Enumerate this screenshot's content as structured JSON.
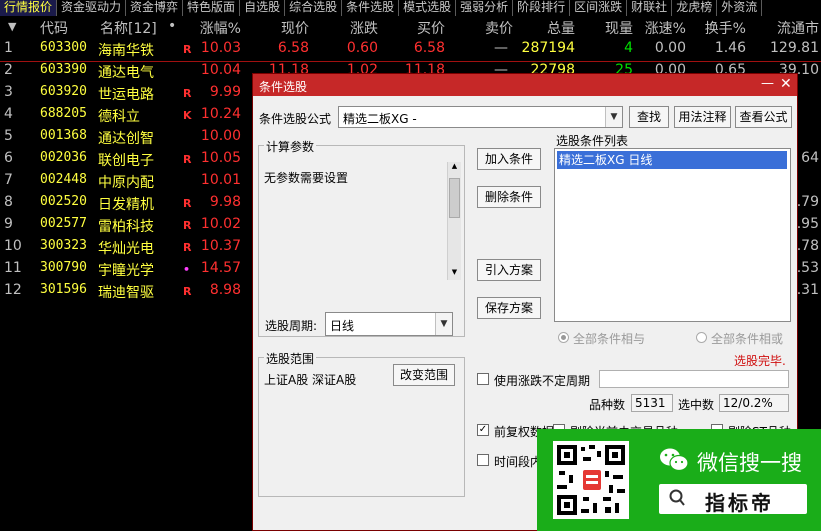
{
  "tabs": [
    "行情报价",
    "资金驱动力",
    "资金博弈",
    "特色版面",
    "自选股",
    "综合选股",
    "条件选股",
    "模式选股",
    "强弱分析",
    "阶段排行",
    "区间涨跌",
    "财联社",
    "龙虎榜",
    "外资流"
  ],
  "columns": {
    "sort": "▼",
    "code": "代码",
    "name": "名称[12]",
    "dot": "•",
    "chg": "涨幅%",
    "price": "现价",
    "diff": "涨跌",
    "bid": "买价",
    "ask": "卖价",
    "vol": "总量",
    "cur": "现量",
    "spd": "涨速%",
    "turn": "换手%",
    "float": "流通市"
  },
  "rows": [
    {
      "idx": "1",
      "code": "603300",
      "name": "海南华铁",
      "flag": "R",
      "chg": "10.03",
      "price": "6.58",
      "diff": "0.60",
      "bid": "6.58",
      "ask": "—",
      "vol": "287194",
      "cur": "4",
      "spd": "0.00",
      "turn": "1.46",
      "float": "129.81"
    },
    {
      "idx": "2",
      "code": "603390",
      "name": "通达电气",
      "flag": "",
      "chg": "10.04",
      "price": "11.18",
      "diff": "1.02",
      "bid": "11.18",
      "ask": "—",
      "vol": "22798",
      "cur": "25",
      "spd": "0.00",
      "turn": "0.65",
      "float": "39.10"
    },
    {
      "idx": "3",
      "code": "603920",
      "name": "世运电路",
      "flag": "R",
      "chg": "9.99",
      "float": ""
    },
    {
      "idx": "4",
      "code": "688205",
      "name": "德科立",
      "flag": "K",
      "chg": "10.24",
      "float": ""
    },
    {
      "idx": "5",
      "code": "001368",
      "name": "通达创智",
      "flag": "",
      "chg": "10.00",
      "float": ""
    },
    {
      "idx": "6",
      "code": "002036",
      "name": "联创电子",
      "flag": "R",
      "chg": "10.05",
      "float": "64"
    },
    {
      "idx": "7",
      "code": "002448",
      "name": "中原内配",
      "flag": "",
      "chg": "10.01",
      "float": ""
    },
    {
      "idx": "8",
      "code": "002520",
      "name": "日发精机",
      "flag": "R",
      "chg": "9.98",
      "float": ".79"
    },
    {
      "idx": "9",
      "code": "002577",
      "name": "雷柏科技",
      "flag": "R",
      "chg": "10.02",
      "float": ".95"
    },
    {
      "idx": "10",
      "code": "300323",
      "name": "华灿光电",
      "flag": "R",
      "chg": "10.37",
      "float": ".78"
    },
    {
      "idx": "11",
      "code": "300790",
      "name": "宇瞳光学",
      "flag": "•",
      "chg": "14.57",
      "float": ".53"
    },
    {
      "idx": "12",
      "code": "301596",
      "name": "瑞迪智驱",
      "flag": "R",
      "chg": "8.98",
      "float": ".31"
    }
  ],
  "dialog": {
    "title": "条件选股",
    "min": "—",
    "close": "✕",
    "formula_label": "条件选股公式",
    "formula_value": "精选二板XG  -",
    "find_btn": "查找",
    "usage_btn": "用法注释",
    "view_btn": "查看公式",
    "params_group": "计算参数",
    "params_text": "无参数需要设置",
    "add_btn": "加入条件",
    "del_btn": "删除条件",
    "import_btn": "引入方案",
    "save_btn": "保存方案",
    "list_label": "选股条件列表",
    "list_items": [
      "精选二板XG  日线"
    ],
    "period_label": "选股周期:",
    "period_value": "日线",
    "radio_and": "全部条件相与",
    "radio_or": "全部条件相或",
    "done_text": "选股完毕.",
    "range_group": "选股范围",
    "range_text": "上证A股 深证A股",
    "change_range_btn": "改变范围",
    "uncertain_label": "使用涨跌不定周期",
    "count_label": "品种数",
    "count_value": "5131",
    "chosen_label": "选中数",
    "chosen_value": "12/0.2%",
    "fq_label": "前复权数据",
    "exclude1": "剔除当前未交易品种",
    "exclude2": "剔除ST品种",
    "time_label": "时间段内"
  },
  "wechat": {
    "title": "微信搜一搜",
    "search": "指标帝"
  },
  "colors": {
    "accent_red": "#c62828",
    "rise": "#ff3030",
    "code_yellow": "#ffff40",
    "wechat_green": "#1aad19"
  }
}
